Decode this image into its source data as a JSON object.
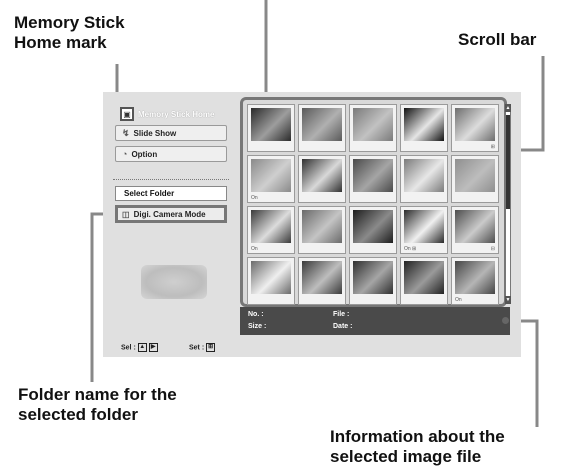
{
  "callouts": {
    "home_mark": [
      "Memory Stick",
      "Home mark"
    ],
    "scroll_bar": "Scroll bar",
    "folder_name": [
      "Folder name for the",
      "selected folder"
    ],
    "info": [
      "Information about the",
      "selected image file"
    ]
  },
  "sidebar": {
    "home_label": "Memory Stick Home",
    "slide_show": "Slide Show",
    "option": "Option",
    "select_folder": "Select Folder",
    "folder_name": "Digi. Camera Mode"
  },
  "info": {
    "no": "No. :",
    "file": "File :",
    "size": "Size :",
    "date": "Date :"
  },
  "footer": {
    "sel": "Sel :",
    "set": "Set :"
  },
  "thumbnails": [
    {
      "c1": "#2a2a2a",
      "c2": "#9d9d9d",
      "mark": ""
    },
    {
      "c1": "#5a5a5a",
      "c2": "#b0b0b0",
      "mark": ""
    },
    {
      "c1": "#7a7a7a",
      "c2": "#c2c2c2",
      "mark": ""
    },
    {
      "c1": "#111111",
      "c2": "#e5e5e5",
      "mark": ""
    },
    {
      "c1": "#6d6d6d",
      "c2": "#dcdcdc",
      "mark": "⊞"
    },
    {
      "c1": "#8a8a8a",
      "c2": "#cfcfcf",
      "mark": "On"
    },
    {
      "c1": "#303030",
      "c2": "#d8d8d8",
      "mark": ""
    },
    {
      "c1": "#4a4a4a",
      "c2": "#a5a5a5",
      "mark": ""
    },
    {
      "c1": "#7a7a7a",
      "c2": "#e7e7e7",
      "mark": ""
    },
    {
      "c1": "#8f8f8f",
      "c2": "#bdbdbd",
      "mark": ""
    },
    {
      "c1": "#3a3a3a",
      "c2": "#dcdcdc",
      "mark": "On"
    },
    {
      "c1": "#6a6a6a",
      "c2": "#c4c4c4",
      "mark": ""
    },
    {
      "c1": "#1d1d1d",
      "c2": "#8a8a8a",
      "mark": ""
    },
    {
      "c1": "#2a2a2a",
      "c2": "#f0f0f0",
      "mark": "On ⊞"
    },
    {
      "c1": "#4d4d4d",
      "c2": "#cacaca",
      "mark": "⊟"
    },
    {
      "c1": "#6a6a6a",
      "c2": "#efefef",
      "mark": ""
    },
    {
      "c1": "#3a3a3a",
      "c2": "#bdbdbd",
      "mark": ""
    },
    {
      "c1": "#2f2f2f",
      "c2": "#a5a5a5",
      "mark": ""
    },
    {
      "c1": "#222222",
      "c2": "#9a9a9a",
      "mark": ""
    },
    {
      "c1": "#454545",
      "c2": "#b5b5b5",
      "mark": "On"
    }
  ]
}
